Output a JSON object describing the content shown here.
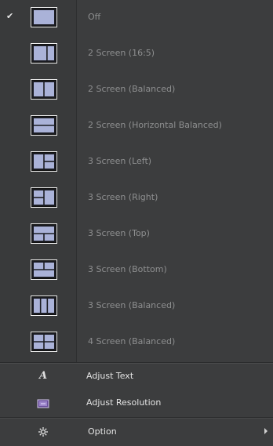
{
  "layout_menu": {
    "items": [
      {
        "label": "Off",
        "icon": "layout-off-icon",
        "checked": true,
        "panes": "off"
      },
      {
        "label": "2 Screen (16:5)",
        "icon": "layout-2-screen-16-5-icon",
        "checked": false,
        "panes": "2-16-5"
      },
      {
        "label": "2 Screen (Balanced)",
        "icon": "layout-2-screen-balanced-icon",
        "checked": false,
        "panes": "2-balanced"
      },
      {
        "label": "2 Screen (Horizontal Balanced)",
        "icon": "layout-2-screen-horizontal-icon",
        "checked": false,
        "panes": "2-horizontal"
      },
      {
        "label": "3 Screen (Left)",
        "icon": "layout-3-screen-left-icon",
        "checked": false,
        "panes": "3-left"
      },
      {
        "label": "3 Screen (Right)",
        "icon": "layout-3-screen-right-icon",
        "checked": false,
        "panes": "3-right"
      },
      {
        "label": "3 Screen (Top)",
        "icon": "layout-3-screen-top-icon",
        "checked": false,
        "panes": "3-top"
      },
      {
        "label": "3 Screen (Bottom)",
        "icon": "layout-3-screen-bottom-icon",
        "checked": false,
        "panes": "3-bottom"
      },
      {
        "label": "3 Screen (Balanced)",
        "icon": "layout-3-screen-balanced-icon",
        "checked": false,
        "panes": "3-balanced"
      },
      {
        "label": "4 Screen (Balanced)",
        "icon": "layout-4-screen-balanced-icon",
        "checked": false,
        "panes": "4-balanced"
      }
    ],
    "check_glyph": "✔"
  },
  "actions": {
    "adjust_text": {
      "label": "Adjust Text",
      "icon": "text-size-icon",
      "glyph": "A"
    },
    "adjust_resolution": {
      "label": "Adjust Resolution",
      "icon": "resolution-icon"
    },
    "option": {
      "label": "Option",
      "icon": "option-gear-icon",
      "has_submenu": true
    }
  },
  "colors": {
    "background": "#3c3d3e",
    "label_disabled": "#8e8f90",
    "label_enabled": "#e4e4e4",
    "icon_fill": "#aab2d8",
    "icon_frame": "#f0f0f0"
  }
}
